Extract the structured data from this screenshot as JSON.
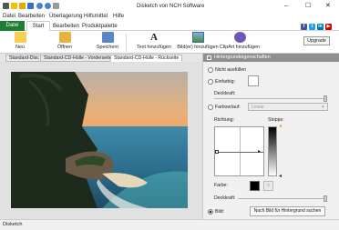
{
  "window": {
    "title": "Disketch von NCH Software",
    "minimize": "–",
    "maximize": "☐",
    "close": "✕"
  },
  "menu": [
    "Datei",
    "Bearbeiten",
    "Überlagerung",
    "Hilfsmittel",
    "Hilfe"
  ],
  "ribbon_tabs": [
    "Datei",
    "Start",
    "Bearbeiten",
    "Produktpalette"
  ],
  "social": [
    "f",
    "t",
    "in",
    "▶"
  ],
  "ribbon": {
    "neu": "Neu",
    "oeffnen": "Öffnen",
    "speichern": "Speichern",
    "text": "Text hinzufügen",
    "bild": "Bild(er) hinzufügen",
    "clipart": "ClipArt hinzufügen",
    "upgrade": "Upgrade"
  },
  "doc_tabs": [
    "Standard-Disc",
    "Standard-CD-Hülle - Vorderseite",
    "Standard-CD-Hülle - Rückseite"
  ],
  "panel": {
    "title": "Hintergrundeigenschaften",
    "nicht": "Nicht ausfüllen",
    "einfarbig": "Einfarbig:",
    "deckkraft": "Deckkraft:",
    "farbverlauf": "Farbverlauf:",
    "verlauf_select": "Linear",
    "richtung": "Richtung:",
    "stopps": "Stopps:",
    "farbe": "Farbe:",
    "x": "x",
    "deckkraft2": "Deckkraft:",
    "bild": "Bild:",
    "bild_button": "Nach Bild für Hintergrund suchen"
  },
  "status": "Disketch",
  "colors": {
    "accent": "#1e7e34",
    "panel_header": "#8f8f8f",
    "ribbon_bg": "#ffffff"
  }
}
